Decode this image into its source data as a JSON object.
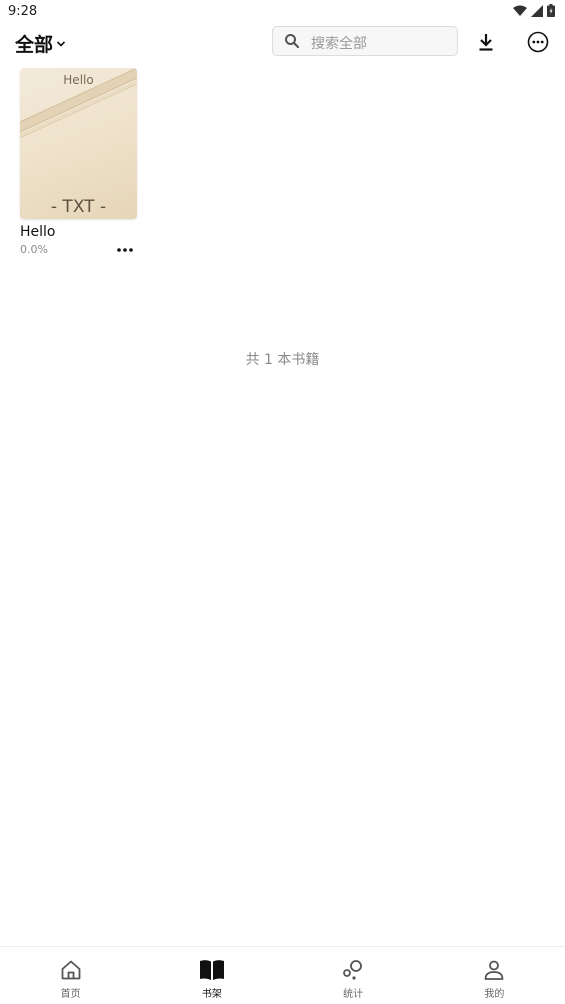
{
  "status_bar": {
    "time": "9:28"
  },
  "toolbar": {
    "filter_label": "全部",
    "search_placeholder": "搜索全部"
  },
  "books": [
    {
      "cover_title": "Hello",
      "cover_format": "- TXT -",
      "title": "Hello",
      "progress": "0.0%"
    }
  ],
  "summary": {
    "count_text": "共 1 本书籍"
  },
  "bottom_nav": {
    "items": [
      {
        "label": "首页",
        "icon": "home-icon",
        "active": false
      },
      {
        "label": "书架",
        "icon": "book-open-icon",
        "active": true
      },
      {
        "label": "统计",
        "icon": "bubbles-icon",
        "active": false
      },
      {
        "label": "我的",
        "icon": "person-icon",
        "active": false
      }
    ]
  },
  "colors": {
    "cover_light": "#f3eadb",
    "cover_dark": "#e6d6b8",
    "cover_text": "#5e503f",
    "muted_text": "#8a8a8a"
  }
}
